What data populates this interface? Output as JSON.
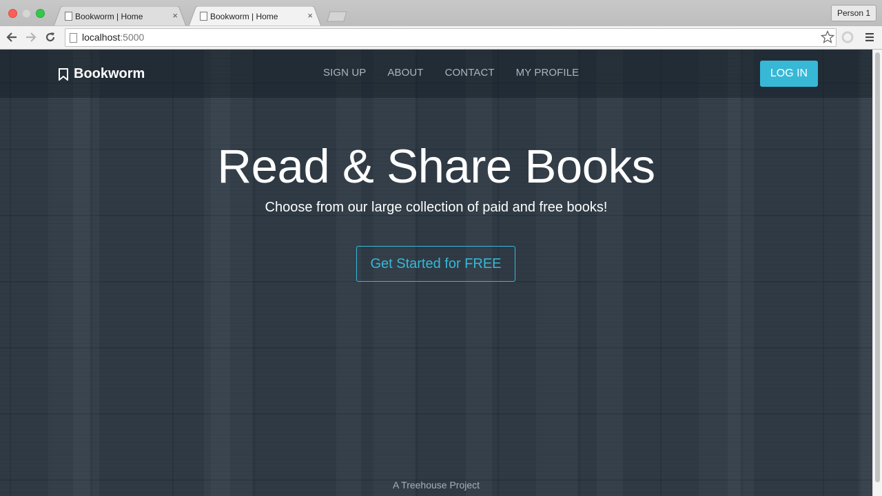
{
  "browser": {
    "tabs": [
      {
        "title": "Bookworm | Home",
        "close": "×"
      },
      {
        "title": "Bookworm | Home",
        "close": "×"
      }
    ],
    "profile": "Person 1",
    "url_host": "localhost",
    "url_port": ":5000"
  },
  "site": {
    "brand": "Bookworm",
    "nav": [
      "SIGN UP",
      "ABOUT",
      "CONTACT",
      "MY PROFILE"
    ],
    "login": "LOG IN",
    "hero_title": "Read & Share Books",
    "hero_subtitle": "Choose from our large collection of paid and free books!",
    "cta": "Get Started for FREE",
    "footer": "A Treehouse Project"
  },
  "colors": {
    "accent": "#37b8d6",
    "background": "#2f3a45"
  }
}
